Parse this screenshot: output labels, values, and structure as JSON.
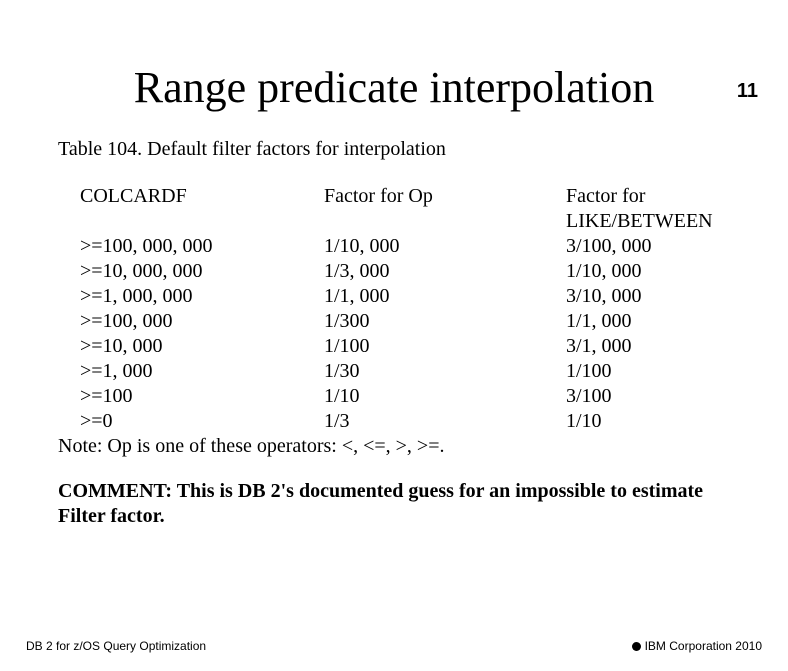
{
  "page_number": "11",
  "title": "Range predicate interpolation",
  "caption": "Table 104. Default filter factors for interpolation",
  "headers": {
    "col1": "COLCARDF",
    "col2": "Factor for Op",
    "col3a": "Factor for",
    "col3b": "LIKE/BETWEEN"
  },
  "rows": [
    {
      "c1": ">=100, 000, 000",
      "c2": "1/10, 000",
      "c3": "3/100, 000"
    },
    {
      "c1": ">=10, 000, 000",
      "c2": "1/3, 000",
      "c3": "1/10, 000"
    },
    {
      "c1": ">=1, 000, 000",
      "c2": "1/1, 000",
      "c3": "3/10, 000"
    },
    {
      "c1": ">=100, 000",
      "c2": "1/300",
      "c3": "1/1, 000"
    },
    {
      "c1": ">=10, 000",
      "c2": "1/100",
      "c3": "3/1, 000"
    },
    {
      "c1": ">=1, 000",
      "c2": "1/30",
      "c3": "1/100"
    },
    {
      "c1": ">=100",
      "c2": "1/10",
      "c3": "3/100"
    },
    {
      "c1": ">=0",
      "c2": "1/3",
      "c3": "1/10"
    }
  ],
  "note": "Note:  Op is one of these operators: <, <=, >, >=.",
  "comment_line1": "COMMENT:  This is DB 2's documented guess for an impossible to estimate",
  "comment_line2": "Filter factor.",
  "footer_left": "DB 2 for z/OS Query Optimization",
  "footer_right": "IBM Corporation 2010"
}
